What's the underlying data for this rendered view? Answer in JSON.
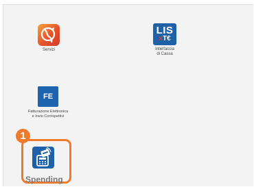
{
  "apps": {
    "servizi": {
      "label": "Servizi",
      "icon": "servizi-icon"
    },
    "lis": {
      "label": "Interfaccia\ndi Cassa",
      "icon_top": "LIS",
      "icon_x": "x",
      "icon_rest": "T€"
    },
    "fe": {
      "label": "Fatturazione Elettronica\ne Invio Corrispettivi",
      "icon_text": "FE"
    },
    "spending": {
      "label": "Spending",
      "icon": "payment-terminal-icon"
    }
  },
  "callout": {
    "number": "1"
  },
  "colors": {
    "accent_orange": "#f07a2a",
    "brand_blue": "#1f61a9",
    "panel_bg": "#f3f3f3"
  }
}
